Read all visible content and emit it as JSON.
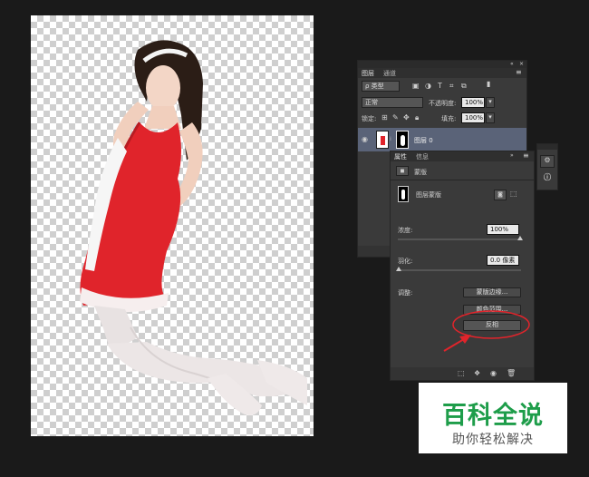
{
  "layers_panel": {
    "tabs": [
      "图层",
      "通道"
    ],
    "filter_kind": "ρ 类型",
    "blend_mode": "正常",
    "opacity_label": "不透明度:",
    "opacity_value": "100%",
    "lock_label": "锁定:",
    "fill_label": "填充:",
    "fill_value": "100%",
    "layer_name": "图层 0"
  },
  "properties_panel": {
    "tabs": [
      "属性",
      "信息"
    ],
    "section_title": "蒙版",
    "mask_type": "图层蒙版",
    "density_label": "浓度:",
    "density_value": "100%",
    "feather_label": "羽化:",
    "feather_value": "0.0 像素",
    "adjust_label": "调整:",
    "btn_mask_edge": "蒙版边缘...",
    "btn_color_range": "颜色范围...",
    "btn_invert": "反相"
  },
  "watermark": {
    "title": "百科全说",
    "subtitle": "助你轻松解决"
  },
  "colors": {
    "accent_red": "#e0242b",
    "brand_green": "#1e9d4a",
    "panel_bg": "#3a3a3a"
  }
}
